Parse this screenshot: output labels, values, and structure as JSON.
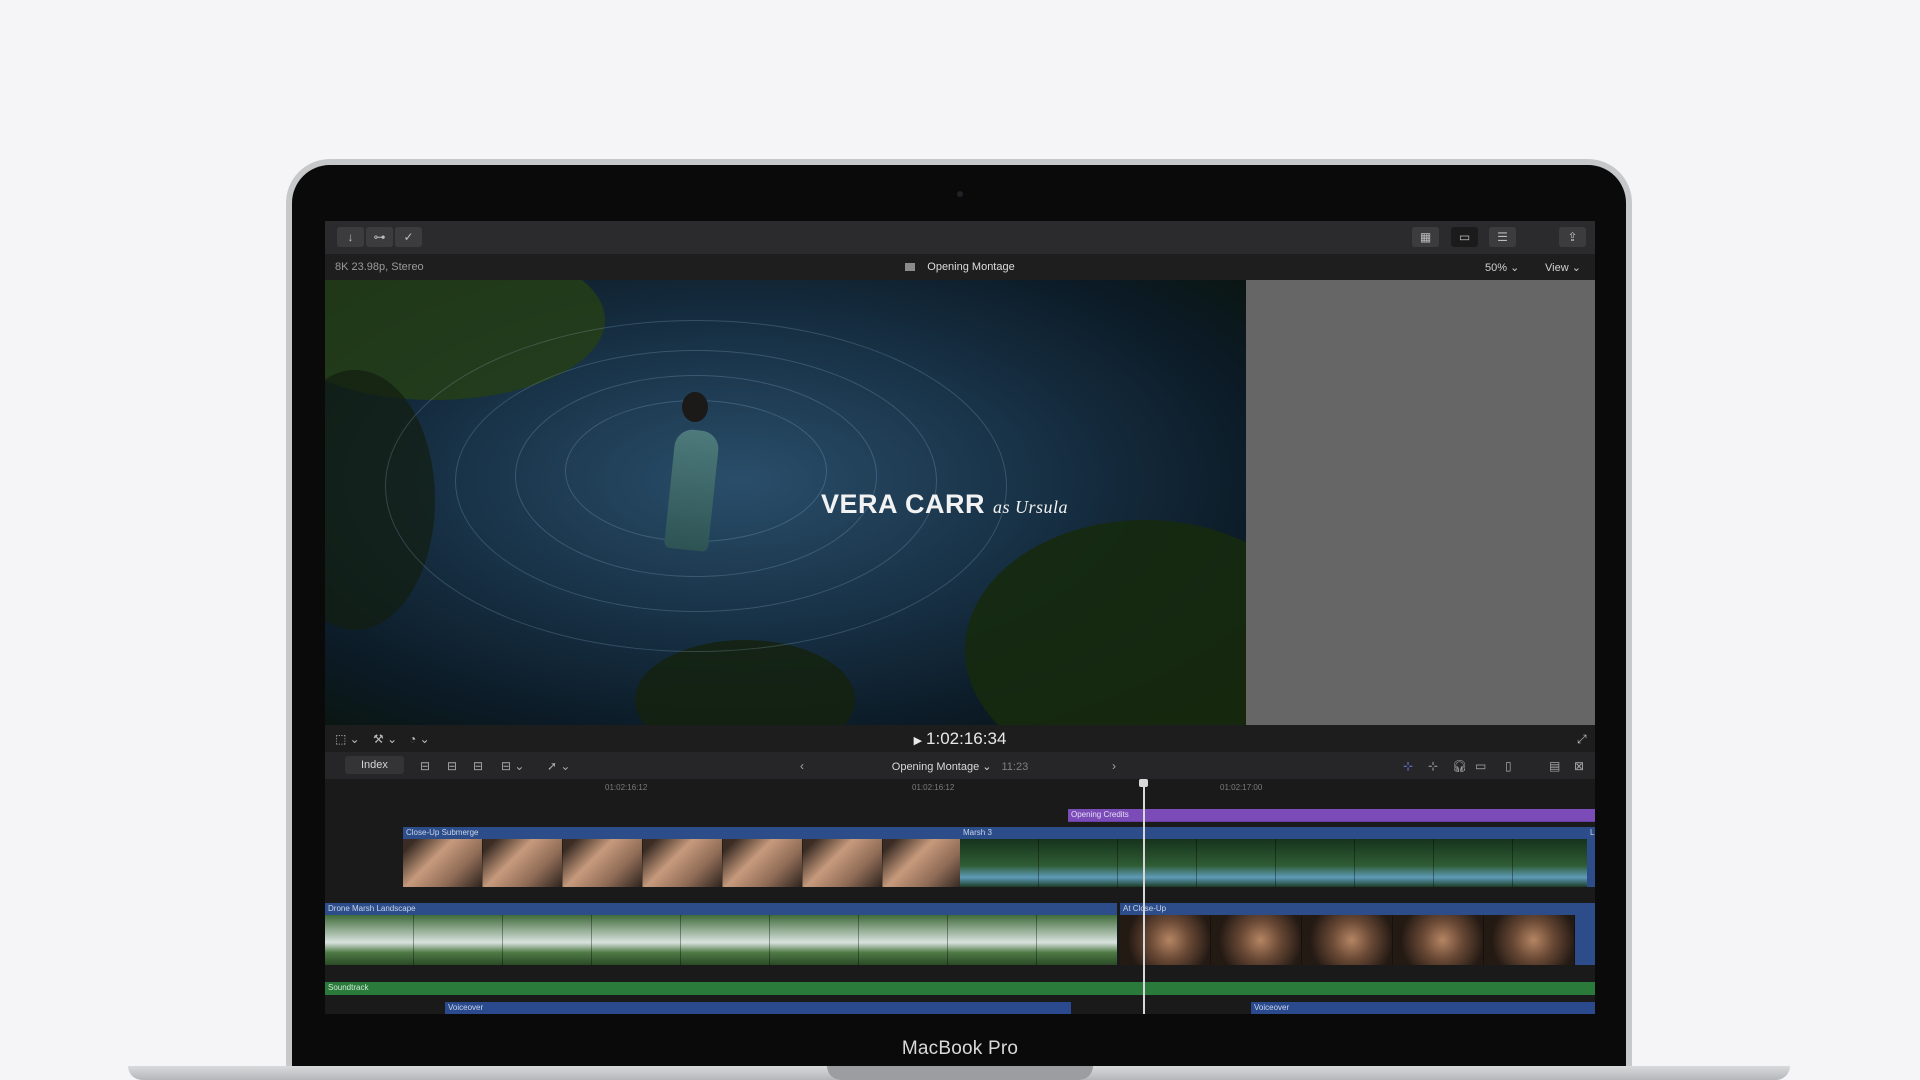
{
  "toolbar": {
    "left_buttons": [
      {
        "icon": "import-arrow-icon",
        "glyph": "↓"
      },
      {
        "icon": "keyword-key-icon",
        "glyph": "⊶"
      },
      {
        "icon": "background-task-check-icon",
        "glyph": "✓"
      }
    ],
    "right_buttons": [
      {
        "icon": "browser-grid-icon",
        "glyph": "▦"
      },
      {
        "icon": "timeline-layout-icon",
        "glyph": "▭"
      },
      {
        "icon": "inspector-sliders-icon",
        "glyph": "☰"
      },
      {
        "icon": "share-icon",
        "glyph": "⇪"
      }
    ]
  },
  "viewer_bar": {
    "format": "8K 23.98p, Stereo",
    "project_title": "Opening Montage",
    "zoom": "50%",
    "view_label": "View"
  },
  "viewer": {
    "title_name": "VERA CARR",
    "title_role": "as Ursula"
  },
  "transport": {
    "timecode": "1:02:16:34"
  },
  "timeline_bar": {
    "index_label": "Index",
    "project": "Opening Montage",
    "duration": "11:23"
  },
  "ruler": {
    "ticks": [
      "01:02:16:12",
      "01:02:16:12",
      "01:02:17:00"
    ]
  },
  "clips": {
    "title_clip": "Opening Credits",
    "upper": [
      "Close-Up Submerge",
      "Marsh 3",
      "Li"
    ],
    "lower": [
      "Drone Marsh Landscape",
      "At Close-Up"
    ],
    "audio": [
      "Soundtrack",
      "Voiceover",
      "Voiceover"
    ]
  },
  "colors": {
    "title_purple": "#6a3fa3",
    "clip_blue": "#2c4c8a",
    "soundtrack_green": "#2a7a3b",
    "voiceover_blue": "#2b4a8e"
  },
  "device": {
    "brand": "MacBook Pro"
  }
}
